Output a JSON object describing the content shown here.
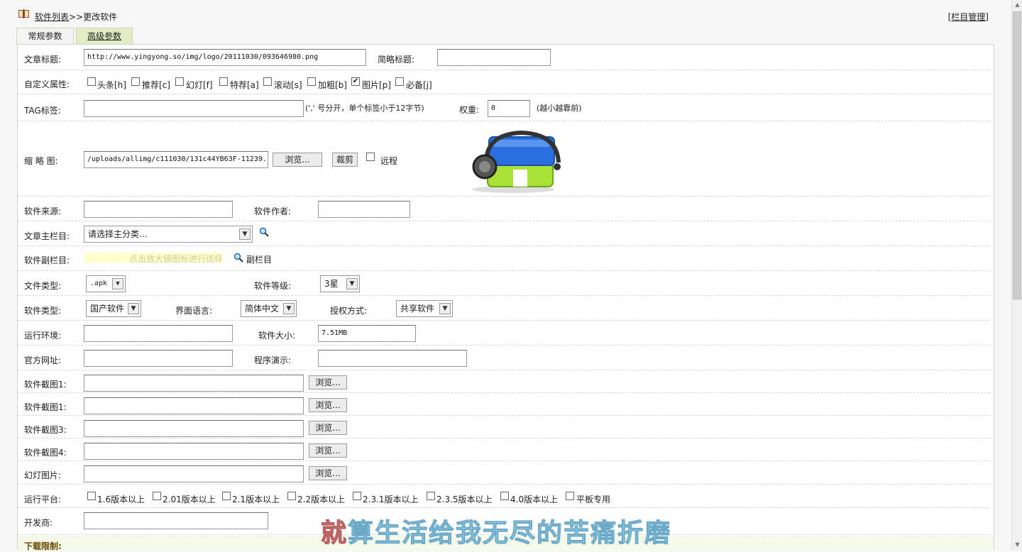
{
  "breadcrumb": {
    "list_link": "软件列表",
    "separator": ">>",
    "current": "更改软件"
  },
  "manage_link": "[栏目管理]",
  "tabs": [
    {
      "label": "常规参数"
    },
    {
      "label": "高级参数"
    }
  ],
  "form": {
    "title_label": "文章标题:",
    "title_value": "http://www.yingyong.so/img/logo/20111030/093646980.png",
    "short_title_label": "简略标题:",
    "short_title_value": "",
    "attr_label": "自定义属性:",
    "attrs": [
      {
        "label": "头条[h]",
        "checked": false
      },
      {
        "label": "推荐[c]",
        "checked": false
      },
      {
        "label": "幻灯[f]",
        "checked": false
      },
      {
        "label": "特荐[a]",
        "checked": false
      },
      {
        "label": "滚动[s]",
        "checked": false
      },
      {
        "label": "加粗[b]",
        "checked": false
      },
      {
        "label": "图片[p]",
        "checked": true
      },
      {
        "label": "必备[j]",
        "checked": false
      }
    ],
    "tag_label": "TAG标签:",
    "tag_value": "",
    "tag_hint": "(',' 号分开，单个标签小于12字节)",
    "weight_label": "权重:",
    "weight_value": "0",
    "weight_hint": "(越小越靠前)",
    "thumb_label": "缩 略 图:",
    "thumb_value": "/uploads/allimg/c111030/131c44YB63F-11239.",
    "browse_label": "浏览...",
    "crop_label": "裁剪",
    "remote_label": "远程",
    "source_label": "软件来源:",
    "source_value": "",
    "author_label": "软件作者:",
    "author_value": "",
    "main_cat_label": "文章主栏目:",
    "main_cat_value": "请选择主分类...",
    "sub_cat_label": "软件副栏目:",
    "sub_cat_hint": "点击放大镜图标进行选择",
    "sub_cat_link": "副栏目",
    "file_type_label": "文件类型:",
    "file_type_value": ".apk",
    "level_label": "软件等级:",
    "level_value": "3星",
    "soft_type_label": "软件类型:",
    "soft_type_value": "国产软件",
    "lang_label": "界面语言:",
    "lang_value": "简体中文",
    "license_label": "授权方式:",
    "license_value": "共享软件",
    "env_label": "运行环境:",
    "env_value": "",
    "size_label": "软件大小:",
    "size_value": "7.51MB",
    "site_label": "官方网址:",
    "site_value": "",
    "demo_label": "程序演示:",
    "demo_value": "",
    "screens": [
      {
        "label": "软件截图1:",
        "value": ""
      },
      {
        "label": "软件截图1:",
        "value": ""
      },
      {
        "label": "软件截图3:",
        "value": ""
      },
      {
        "label": "软件截图4:",
        "value": ""
      },
      {
        "label": "幻灯图片:",
        "value": ""
      }
    ],
    "platform_label": "运行平台:",
    "platforms": [
      {
        "label": "1.6版本以上"
      },
      {
        "label": "2.01版本以上"
      },
      {
        "label": "2.1版本以上"
      },
      {
        "label": "2.2版本以上"
      },
      {
        "label": "2.3.1版本以上"
      },
      {
        "label": "2.3.5版本以上"
      },
      {
        "label": "4.0版本以上"
      },
      {
        "label": "平板专用"
      }
    ],
    "dev_label": "开发商:",
    "dev_value": "",
    "download_limit_label": "下载限制:"
  },
  "overlay_subtitle": {
    "first_char": "就",
    "rest": "算生活给我无尽的苦痛折磨"
  }
}
